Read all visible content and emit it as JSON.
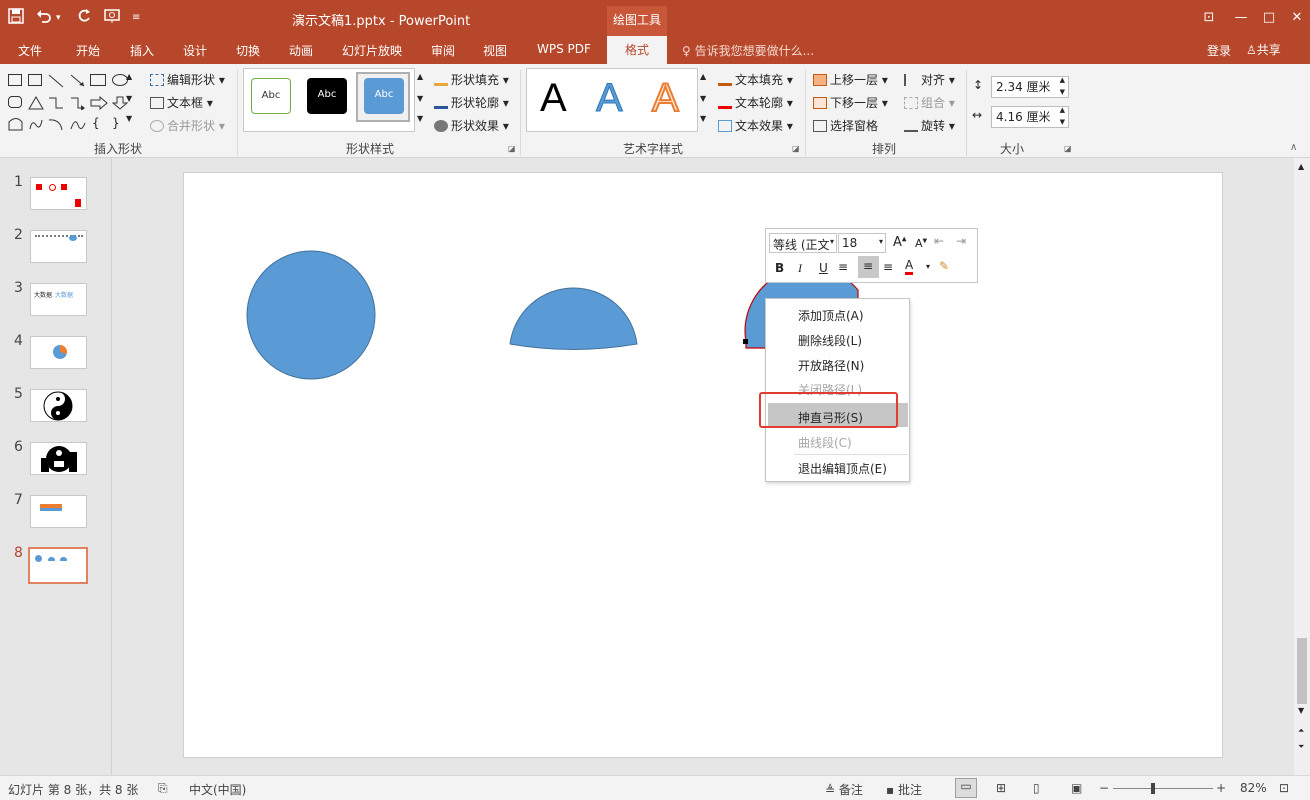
{
  "title_bar": {
    "title": "演示文稿1.pptx - PowerPoint",
    "context_tab": "绘图工具",
    "quick_access": [
      "save-icon",
      "undo-icon",
      "undo-dropdown-icon",
      "redo-icon",
      "start-slideshow-icon",
      "customize-icon"
    ]
  },
  "tabs": [
    "文件",
    "开始",
    "插入",
    "设计",
    "切换",
    "动画",
    "幻灯片放映",
    "审阅",
    "视图",
    "WPS PDF",
    "格式"
  ],
  "active_tab": "格式",
  "tell_me": "告诉我您想要做什么...",
  "login": "登录",
  "share": "共享",
  "ribbon": {
    "insert_shapes": {
      "label": "插入形状",
      "edit_shape": "编辑形状",
      "text_box": "文本框",
      "merge_shapes": "合并形状"
    },
    "shape_styles": {
      "label": "形状样式",
      "style1": "Abc",
      "style2": "Abc",
      "style3": "Abc",
      "fill": "形状填充",
      "outline": "形状轮廓",
      "effects": "形状效果"
    },
    "wordart": {
      "label": "艺术字样式",
      "a1": "A",
      "a2": "A",
      "a3": "A",
      "text_fill": "文本填充",
      "text_outline": "文本轮廓",
      "text_effects": "文本效果"
    },
    "arrange": {
      "label": "排列",
      "bring_forward": "上移一层",
      "send_backward": "下移一层",
      "selection_pane": "选择窗格",
      "align": "对齐",
      "group": "组合",
      "rotate": "旋转"
    },
    "size": {
      "label": "大小",
      "height": "2.34 厘米",
      "width": "4.16 厘米"
    }
  },
  "thumbnails": [
    "1",
    "2",
    "3",
    "4",
    "5",
    "6",
    "7",
    "8"
  ],
  "thumb_texts": {
    "t3a": "大数据",
    "t3b": "大数据"
  },
  "active_slide": 8,
  "mini_toolbar": {
    "font": "等线 (正文",
    "size": "18",
    "bold": "B",
    "italic": "I",
    "underline": "U",
    "font_color": "A",
    "grow": "A",
    "shrink": "A"
  },
  "context_menu": [
    {
      "label": "添加顶点(A)",
      "enabled": true
    },
    {
      "label": "删除线段(L)",
      "enabled": true
    },
    {
      "label": "开放路径(N)",
      "enabled": true
    },
    {
      "label": "关闭路径(L)",
      "enabled": false
    },
    {
      "label": "抻直弓形(S)",
      "enabled": true,
      "highlighted": true
    },
    {
      "label": "曲线段(C)",
      "enabled": false
    },
    {
      "label": "退出编辑顶点(E)",
      "enabled": true
    }
  ],
  "status_bar": {
    "slide_info": "幻灯片 第 8 张，共 8 张",
    "language": "中文(中国)",
    "notes": "备注",
    "comments": "批注",
    "zoom": "82%"
  },
  "colors": {
    "brand": "#b7472a",
    "shape_fill": "#5b9bd5",
    "shape_stroke": "#41719c",
    "highlight_box": "#e03c31"
  }
}
